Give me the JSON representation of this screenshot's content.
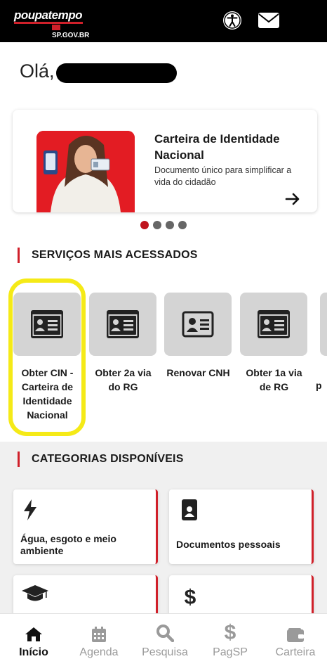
{
  "header": {
    "logo_text": "poupatempo",
    "logo_sub": "SP.GOV.BR",
    "accessibility_icon": "accessibility-icon",
    "mail_icon": "mail-icon"
  },
  "greeting": {
    "text": "Olá,"
  },
  "banner": {
    "title": "Carteira de Identidade Nacional",
    "description": "Documento único para simplificar a vida do cidadão",
    "arrow_icon": "arrow-right-icon",
    "slides": 4,
    "active_slide": 1
  },
  "services": {
    "title": "SERVIÇOS MAIS ACESSADOS",
    "items": [
      {
        "label": "Obter CIN - Carteira de Identidade Nacional",
        "icon": "id-card-icon"
      },
      {
        "label": "Obter 2a via do RG",
        "icon": "id-card-icon"
      },
      {
        "label": "Renovar CNH",
        "icon": "id-card-outline-icon"
      },
      {
        "label": "Obter 1a via de RG",
        "icon": "id-card-icon"
      }
    ],
    "peek_label": "p"
  },
  "categories": {
    "title": "CATEGORIAS DISPONÍVEIS",
    "items": [
      {
        "label": "Água, esgoto e meio ambiente",
        "icon": "lightning-icon"
      },
      {
        "label": "Documentos pessoais",
        "icon": "badge-icon"
      },
      {
        "label": "",
        "icon": "graduation-cap-icon"
      },
      {
        "label": "",
        "icon": "dollar-icon"
      }
    ]
  },
  "nav": {
    "items": [
      {
        "label": "Início",
        "icon": "home-icon",
        "active": true
      },
      {
        "label": "Agenda",
        "icon": "calendar-icon",
        "active": false
      },
      {
        "label": "Pesquisa",
        "icon": "search-icon",
        "active": false
      },
      {
        "label": "PagSP",
        "icon": "dollar-icon",
        "active": false
      },
      {
        "label": "Carteira",
        "icon": "wallet-icon",
        "active": false
      }
    ]
  },
  "colors": {
    "brand_red": "#d0202a",
    "highlight_yellow": "#f5ea17",
    "header_bg": "#000000"
  }
}
